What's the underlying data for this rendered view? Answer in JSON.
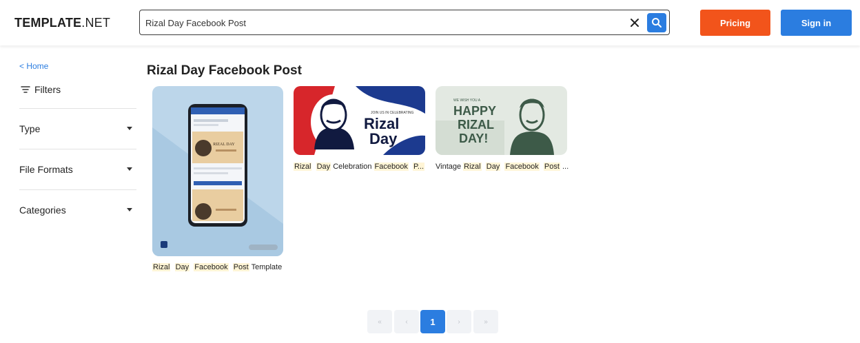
{
  "header": {
    "logo_bold": "TEMPLATE",
    "logo_rest": ".NET",
    "search_value": "Rizal Day Facebook Post",
    "pricing_label": "Pricing",
    "signin_label": "Sign in"
  },
  "sidebar": {
    "home_label": "< Home",
    "filters_label": "Filters",
    "filters": [
      {
        "label": "Type"
      },
      {
        "label": "File Formats"
      },
      {
        "label": "Categories"
      }
    ]
  },
  "main": {
    "title": "Rizal Day Facebook Post",
    "cards": [
      {
        "title_words": [
          "Rizal",
          "Day",
          "Facebook",
          "Post"
        ],
        "title_rest": "Template"
      },
      {
        "title_words": [
          "Rizal",
          "Day"
        ],
        "title_mid": "Celebration",
        "title_words2": [
          "Facebook",
          "P..."
        ]
      },
      {
        "title_pre": "Vintage",
        "title_words": [
          "Rizal",
          "Day",
          "Facebook",
          "Post",
          "..."
        ]
      }
    ],
    "card2_art": {
      "small_text": "JOIN US IN CELEBRATING",
      "line1": "Rizal",
      "line2": "Day"
    },
    "card3_art": {
      "small_text": "WE WISH YOU A",
      "line1": "HAPPY",
      "line2": "RIZAL",
      "line3": "DAY!"
    },
    "card1_art": {
      "header_text": "RIZAL DAY"
    }
  },
  "pagination": {
    "first": "«",
    "prev": "‹",
    "current": "1",
    "next": "›",
    "last": "»"
  }
}
